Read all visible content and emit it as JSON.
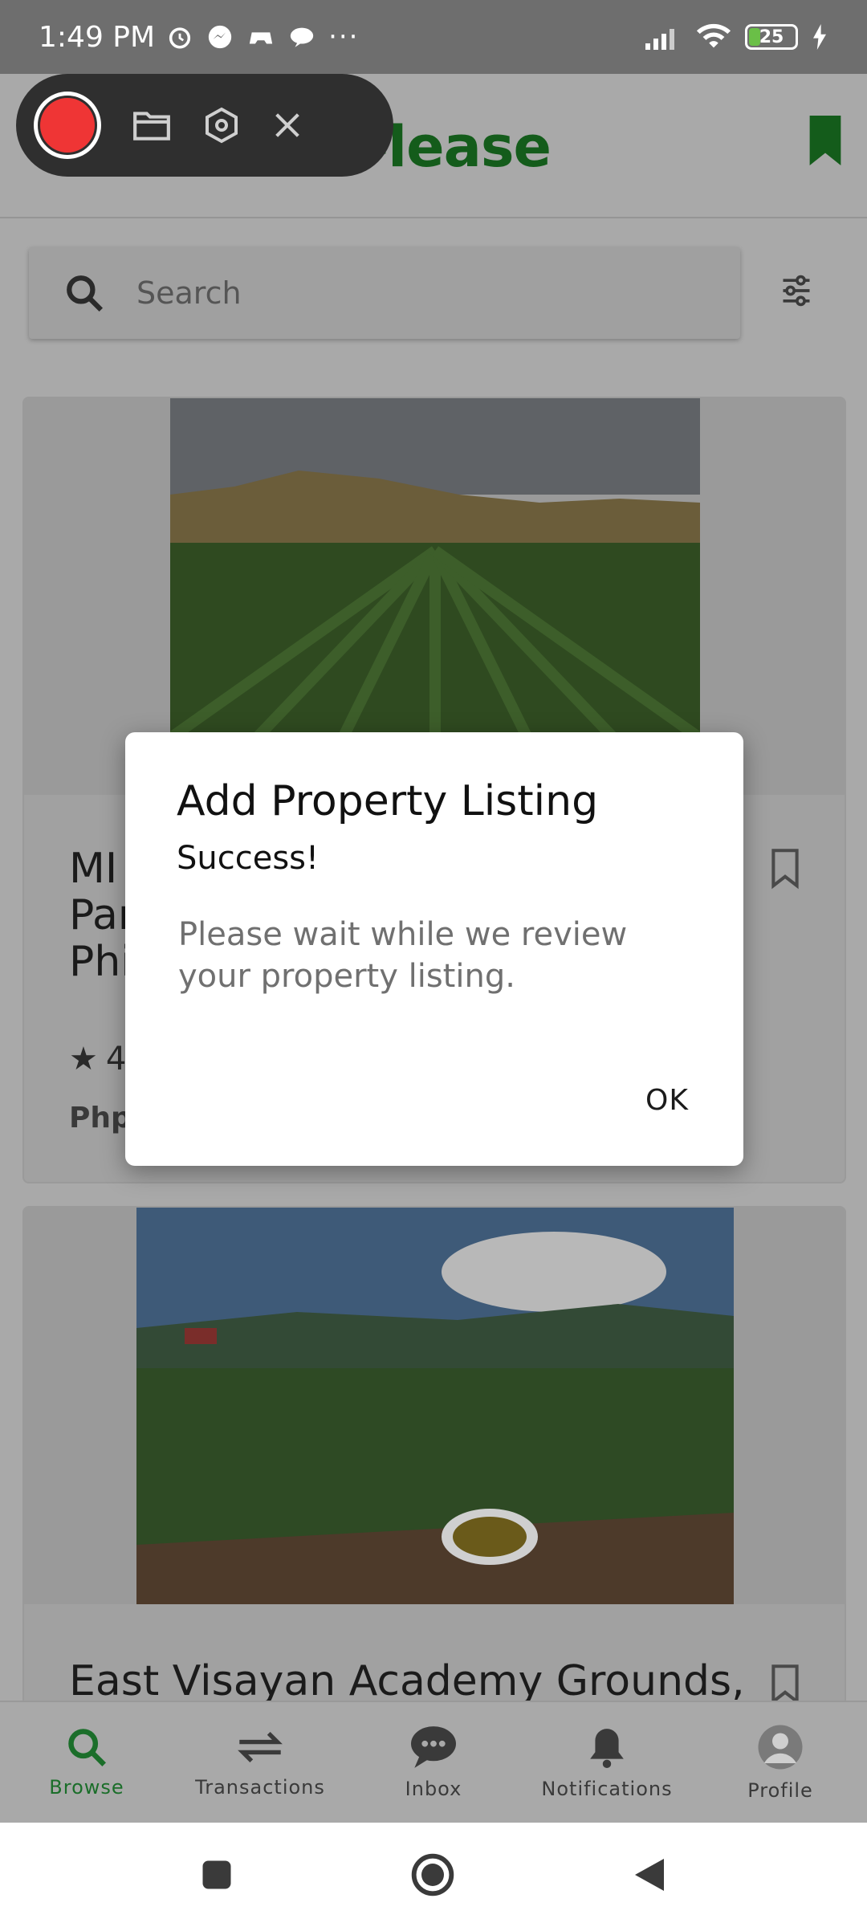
{
  "status_bar": {
    "time": "1:49 PM",
    "battery_level": "25"
  },
  "app_bar": {
    "logo_text": "b-lease"
  },
  "search": {
    "placeholder": "Search"
  },
  "cards": [
    {
      "title_line1": "MI",
      "title_line2": "Par",
      "title_line3": "Phi",
      "rating_partial": "4",
      "price_partial": "Php"
    },
    {
      "title": "East Visayan Academy Grounds,"
    }
  ],
  "dialog": {
    "title": "Add Property Listing",
    "subtitle": "Success!",
    "message": "Please wait while we review your property listing.",
    "ok_label": "OK"
  },
  "bottom_nav": {
    "items": [
      {
        "label": "Browse",
        "icon": "search-icon"
      },
      {
        "label": "Transactions",
        "icon": "swap-arrows-icon"
      },
      {
        "label": "Inbox",
        "icon": "chat-bubble-icon"
      },
      {
        "label": "Notifications",
        "icon": "bell-icon"
      },
      {
        "label": "Profile",
        "icon": "avatar-icon"
      }
    ],
    "active_color": "#1b6e2a"
  },
  "colors": {
    "recorder_red": "#ef3535",
    "brand_green": "#145c1b"
  }
}
